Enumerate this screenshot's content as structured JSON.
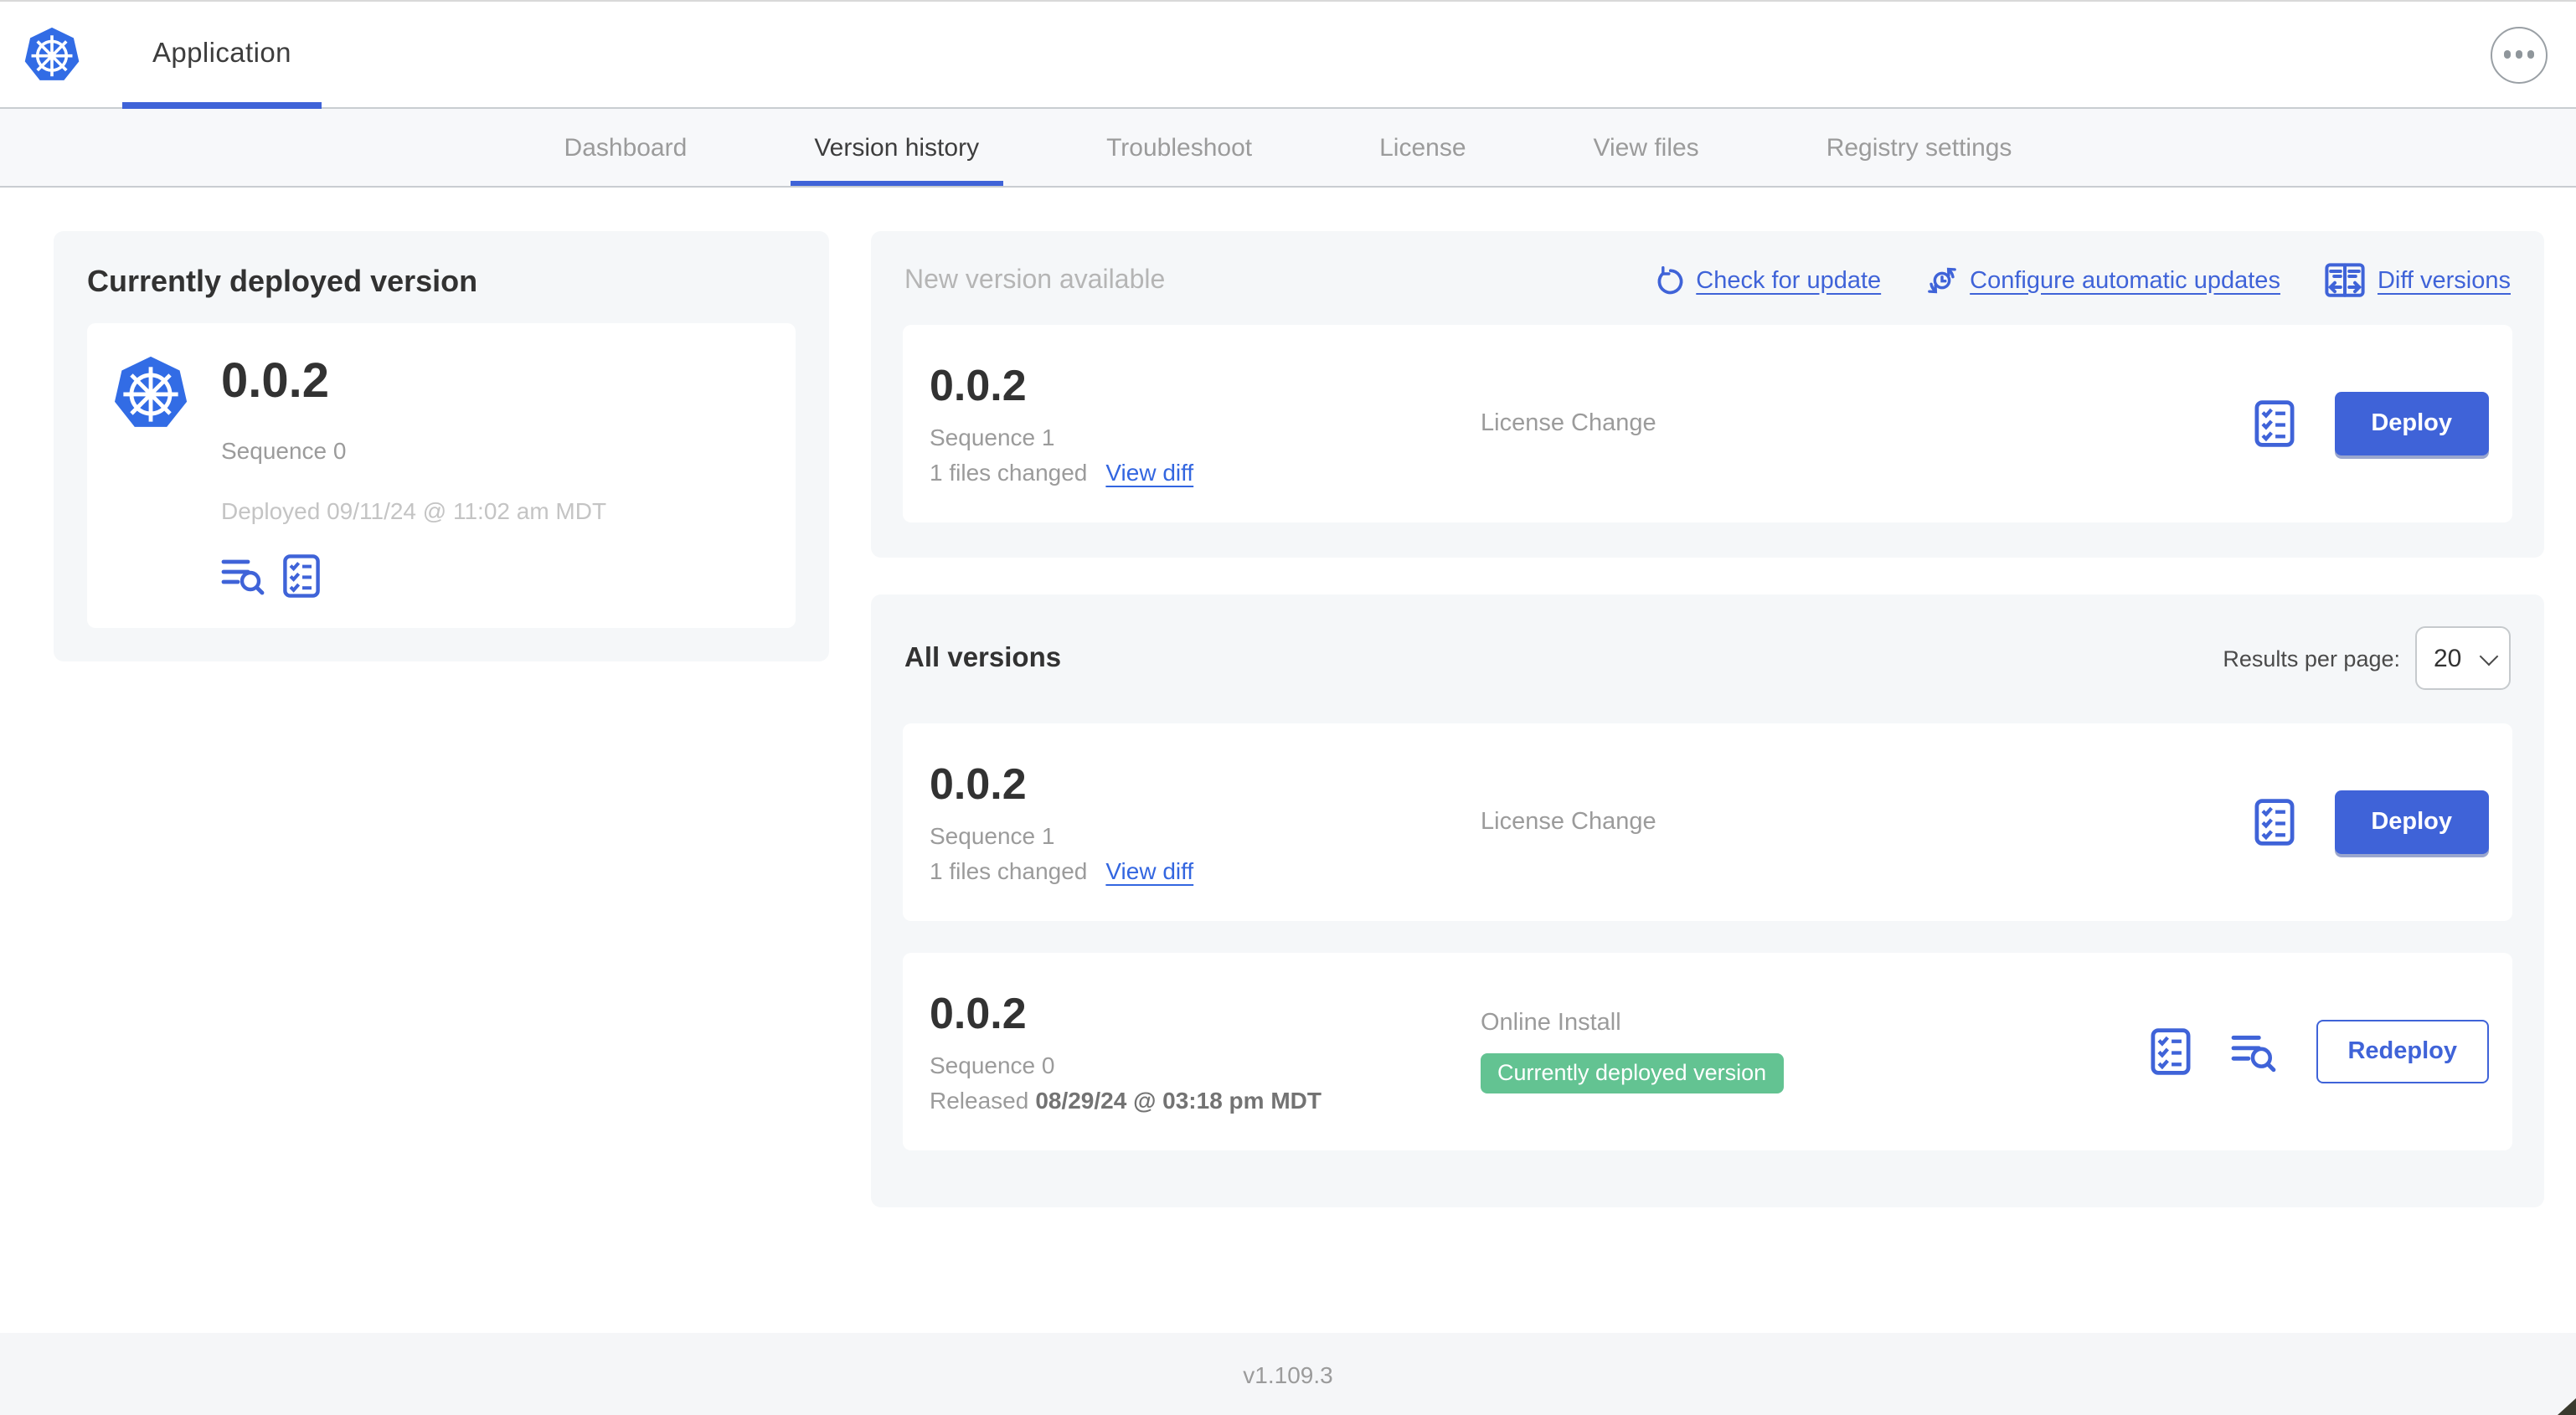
{
  "header": {
    "app_tab_label": "Application"
  },
  "nav": {
    "tabs": [
      {
        "label": "Dashboard",
        "active": false
      },
      {
        "label": "Version history",
        "active": true
      },
      {
        "label": "Troubleshoot",
        "active": false
      },
      {
        "label": "License",
        "active": false
      },
      {
        "label": "View files",
        "active": false
      },
      {
        "label": "Registry settings",
        "active": false
      }
    ]
  },
  "current_deployed": {
    "title": "Currently deployed version",
    "version": "0.0.2",
    "sequence": "Sequence 0",
    "deployed": "Deployed 09/11/24 @ 11:02 am MDT"
  },
  "new_version": {
    "title": "New version available",
    "links": {
      "check_for_update": "Check for update",
      "configure_automatic_updates": "Configure automatic updates",
      "diff_versions": "Diff versions"
    },
    "row": {
      "version": "0.0.2",
      "sequence": "Sequence 1",
      "files_changed": "1 files changed",
      "view_diff": "View diff",
      "source": "License Change",
      "action": "Deploy"
    }
  },
  "all_versions": {
    "title": "All versions",
    "results_per_page_label": "Results per page:",
    "results_per_page_value": "20",
    "rows": {
      "0": {
        "version": "0.0.2",
        "sequence": "Sequence 1",
        "files_changed": "1 files changed",
        "view_diff": "View diff",
        "source": "License Change",
        "action": "Deploy"
      },
      "1": {
        "version": "0.0.2",
        "sequence": "Sequence 0",
        "released_label": "Released",
        "released_date": "08/29/24 @ 03:18 pm MDT",
        "source": "Online Install",
        "badge": "Currently deployed version",
        "action": "Redeploy"
      }
    }
  },
  "footer": {
    "version": "v1.109.3"
  },
  "colors": {
    "accent": "#3f63d8",
    "kubernetes_blue": "#326ce5",
    "badge_green": "#63c392",
    "panel_bg": "#f5f7f9",
    "muted_text": "#9b9b9b"
  }
}
